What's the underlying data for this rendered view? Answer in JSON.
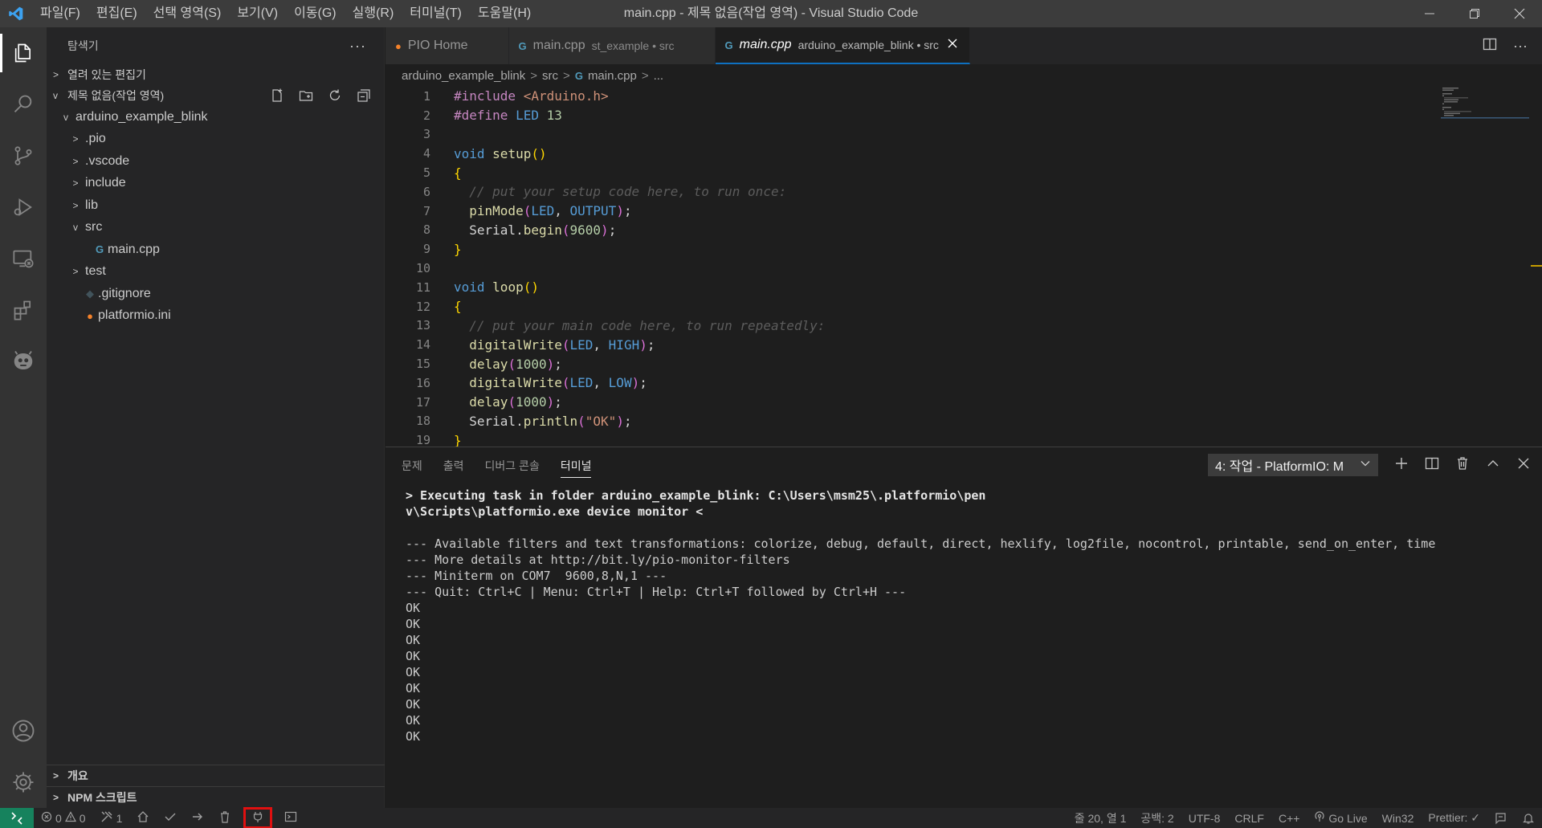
{
  "titlebar": {
    "menu": [
      "파일(F)",
      "편집(E)",
      "선택 영역(S)",
      "보기(V)",
      "이동(G)",
      "실행(R)",
      "터미널(T)",
      "도움말(H)"
    ],
    "title": "main.cpp - 제목 없음(작업 영역) - Visual Studio Code"
  },
  "sidebar": {
    "title": "탐색기",
    "open_editors": "열려 있는 편집기",
    "workspace": "제목 없음(작업 영역)",
    "tree": [
      {
        "label": "arduino_example_blink",
        "chev": "v",
        "indent": 0,
        "icon": ""
      },
      {
        "label": ".pio",
        "chev": ">",
        "indent": 1,
        "icon": ""
      },
      {
        "label": ".vscode",
        "chev": ">",
        "indent": 1,
        "icon": ""
      },
      {
        "label": "include",
        "chev": ">",
        "indent": 1,
        "icon": ""
      },
      {
        "label": "lib",
        "chev": ">",
        "indent": 1,
        "icon": ""
      },
      {
        "label": "src",
        "chev": "v",
        "indent": 1,
        "icon": ""
      },
      {
        "label": "main.cpp",
        "chev": "",
        "indent": 2,
        "icon": "cpp"
      },
      {
        "label": "test",
        "chev": ">",
        "indent": 1,
        "icon": ""
      },
      {
        "label": ".gitignore",
        "chev": "",
        "indent": 1,
        "icon": "git"
      },
      {
        "label": "platformio.ini",
        "chev": "",
        "indent": 1,
        "icon": "pio"
      }
    ],
    "outline": "개요",
    "npm": "NPM 스크립트"
  },
  "tabs": [
    {
      "name": "PIO Home",
      "desc": "",
      "icon": "pio",
      "active": false
    },
    {
      "name": "main.cpp",
      "desc": "st_example • src",
      "icon": "cpp",
      "active": false
    },
    {
      "name": "main.cpp",
      "desc": "arduino_example_blink • src",
      "icon": "cpp",
      "active": true
    }
  ],
  "breadcrumb": [
    "arduino_example_blink",
    "src",
    "main.cpp",
    "..."
  ],
  "code_lines": [
    {
      "n": "1",
      "html": "<span class=\"kw\">#include</span> <span class=\"str\">&lt;Arduino.h&gt;</span>"
    },
    {
      "n": "2",
      "html": "<span class=\"kw\">#define</span> <span class=\"macro\">LED</span> <span class=\"num\">13</span>"
    },
    {
      "n": "3",
      "html": ""
    },
    {
      "n": "4",
      "html": "<span class=\"kw2\">void</span> <span class=\"fn\">setup</span><span class=\"brace\">()</span>"
    },
    {
      "n": "5",
      "html": "<span class=\"brace\">{</span>"
    },
    {
      "n": "6",
      "html": "  <span class=\"cm\">// put your setup code here, to run once:</span>"
    },
    {
      "n": "7",
      "html": "  <span class=\"fn\">pinMode</span><span class=\"brace2\">(</span><span class=\"macro\">LED</span><span class=\"plain\">, </span><span class=\"macro\">OUTPUT</span><span class=\"brace2\">)</span><span class=\"plain\">;</span>"
    },
    {
      "n": "8",
      "html": "  <span class=\"plain\">Serial.</span><span class=\"fn\">begin</span><span class=\"brace2\">(</span><span class=\"num\">9600</span><span class=\"brace2\">)</span><span class=\"plain\">;</span>"
    },
    {
      "n": "9",
      "html": "<span class=\"brace\">}</span>"
    },
    {
      "n": "10",
      "html": ""
    },
    {
      "n": "11",
      "html": "<span class=\"kw2\">void</span> <span class=\"fn\">loop</span><span class=\"brace\">()</span>"
    },
    {
      "n": "12",
      "html": "<span class=\"brace\">{</span>"
    },
    {
      "n": "13",
      "html": "  <span class=\"cm\">// put your main code here, to run repeatedly:</span>"
    },
    {
      "n": "14",
      "html": "  <span class=\"fn\">digitalWrite</span><span class=\"brace2\">(</span><span class=\"macro\">LED</span><span class=\"plain\">, </span><span class=\"macro\">HIGH</span><span class=\"brace2\">)</span><span class=\"plain\">;</span>"
    },
    {
      "n": "15",
      "html": "  <span class=\"fn\">delay</span><span class=\"brace2\">(</span><span class=\"num\">1000</span><span class=\"brace2\">)</span><span class=\"plain\">;</span>"
    },
    {
      "n": "16",
      "html": "  <span class=\"fn\">digitalWrite</span><span class=\"brace2\">(</span><span class=\"macro\">LED</span><span class=\"plain\">, </span><span class=\"macro\">LOW</span><span class=\"brace2\">)</span><span class=\"plain\">;</span>"
    },
    {
      "n": "17",
      "html": "  <span class=\"fn\">delay</span><span class=\"brace2\">(</span><span class=\"num\">1000</span><span class=\"brace2\">)</span><span class=\"plain\">;</span>"
    },
    {
      "n": "18",
      "html": "  <span class=\"plain\">Serial.</span><span class=\"fn\">println</span><span class=\"brace2\">(</span><span class=\"str\">\"OK\"</span><span class=\"brace2\">)</span><span class=\"plain\">;</span>"
    },
    {
      "n": "19",
      "html": "<span class=\"brace\">}</span>"
    }
  ],
  "panel": {
    "tabs": [
      "문제",
      "출력",
      "디버그 콘솔",
      "터미널"
    ],
    "active_tab": "터미널",
    "terminal_select": "4: 작업 - PlatformIO: M",
    "lines": [
      {
        "t": "> Executing task in folder arduino_example_blink: C:\\Users\\msm25\\.platformio\\pen",
        "bold": true
      },
      {
        "t": "v\\Scripts\\platformio.exe device monitor <",
        "bold": true
      },
      {
        "t": "",
        "bold": false
      },
      {
        "t": "--- Available filters and text transformations: colorize, debug, default, direct, hexlify, log2file, nocontrol, printable, send_on_enter, time",
        "bold": false
      },
      {
        "t": "--- More details at http://bit.ly/pio-monitor-filters",
        "bold": false
      },
      {
        "t": "--- Miniterm on COM7  9600,8,N,1 ---",
        "bold": false
      },
      {
        "t": "--- Quit: Ctrl+C | Menu: Ctrl+T | Help: Ctrl+T followed by Ctrl+H ---",
        "bold": false
      },
      {
        "t": "OK",
        "bold": false
      },
      {
        "t": "OK",
        "bold": false
      },
      {
        "t": "OK",
        "bold": false
      },
      {
        "t": "OK",
        "bold": false
      },
      {
        "t": "OK",
        "bold": false
      },
      {
        "t": "OK",
        "bold": false
      },
      {
        "t": "OK",
        "bold": false
      },
      {
        "t": "OK",
        "bold": false
      },
      {
        "t": "OK",
        "bold": false
      }
    ]
  },
  "statusbar": {
    "errors": "0",
    "warnings": "0",
    "tasks": "1",
    "cursor": "줄 20, 열 1",
    "spaces": "공백: 2",
    "encoding": "UTF-8",
    "eol": "CRLF",
    "language": "C++",
    "golive": "Go Live",
    "platform": "Win32",
    "prettier": "Prettier: ✓"
  },
  "colors": {
    "accent": "#0e70c0",
    "remote": "#16825d",
    "highlight": "#e01010"
  }
}
